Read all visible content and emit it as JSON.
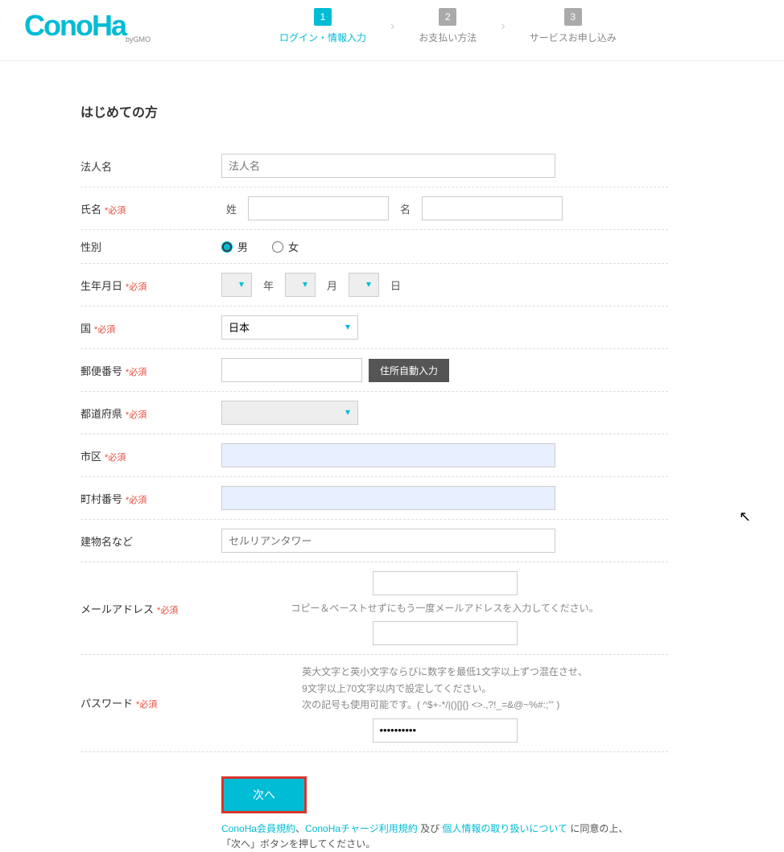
{
  "brand": {
    "name": "ConoHa",
    "sub": "byGMO"
  },
  "steps": [
    {
      "num": "1",
      "label": "ログイン・情報入力",
      "active": true
    },
    {
      "num": "2",
      "label": "お支払い方法",
      "active": false
    },
    {
      "num": "3",
      "label": "サービスお申し込み",
      "active": false
    }
  ],
  "heading": "はじめての方",
  "labels": {
    "company": "法人名",
    "name": "氏名",
    "sei": "姓",
    "mei": "名",
    "gender": "性別",
    "male": "男",
    "female": "女",
    "dob": "生年月日",
    "year": "年",
    "month": "月",
    "day": "日",
    "country": "国",
    "zip": "郵便番号",
    "autozip": "住所自動入力",
    "pref": "都道府県",
    "city": "市区",
    "town": "町村番号",
    "building": "建物名など",
    "email": "メールアドレス",
    "password": "パスワード",
    "required": "*必須"
  },
  "placeholders": {
    "company": "法人名",
    "building": "セルリアンタワー"
  },
  "values": {
    "country": "日本",
    "gender": "male",
    "password": "●●●●●●●●●●"
  },
  "hints": {
    "email": "コピー＆ペーストせずにもう一度メールアドレスを入力してください。",
    "pw1": "英大文字と英小文字ならびに数字を最低1文字以上ずつ混在させ、",
    "pw2": "9文字以上70文字以内で設定してください。",
    "pw3": "次の記号も使用可能です。( ^$+-*/|()[]{} <>.,?!_=&@~%#:;'\" )"
  },
  "submit": {
    "next": "次へ",
    "link1": "ConoHa会員規約",
    "sep1": "、",
    "link2": "ConoHaチャージ利用規約 ",
    "mid": "及び ",
    "link3": "個人情報の取り扱いについて ",
    "tail": "に同意の上、",
    "line2": "「次へ」ボタンを押してください。"
  }
}
